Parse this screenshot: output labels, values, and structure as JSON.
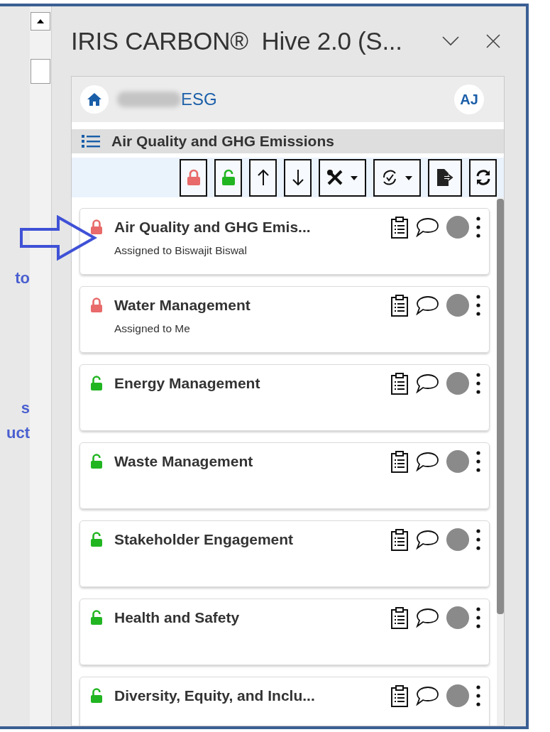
{
  "document_fragments": [
    "to",
    "s",
    "uct"
  ],
  "pane": {
    "title": "IRIS CARBON®  Hive 2.0 (S..."
  },
  "header": {
    "workspace": "ESG",
    "avatar": "AJ"
  },
  "section": {
    "title": "Air Quality and GHG Emissions"
  },
  "toolbar": [
    {
      "kind": "lock"
    },
    {
      "kind": "unlock"
    },
    {
      "kind": "up"
    },
    {
      "kind": "down"
    },
    {
      "kind": "tools"
    },
    {
      "kind": "cycle"
    },
    {
      "kind": "export"
    },
    {
      "kind": "refresh"
    }
  ],
  "cards": [
    {
      "title": "Air Quality and GHG Emis...",
      "locked": true,
      "assignee": "Assigned to Biswajit Biswal"
    },
    {
      "title": "Water Management",
      "locked": true,
      "assignee": "Assigned to Me"
    },
    {
      "title": "Energy Management",
      "locked": false
    },
    {
      "title": "Waste Management",
      "locked": false
    },
    {
      "title": "Stakeholder Engagement",
      "locked": false
    },
    {
      "title": "Health and Safety",
      "locked": false
    },
    {
      "title": "Diversity, Equity, and Inclu...",
      "locked": false
    }
  ]
}
